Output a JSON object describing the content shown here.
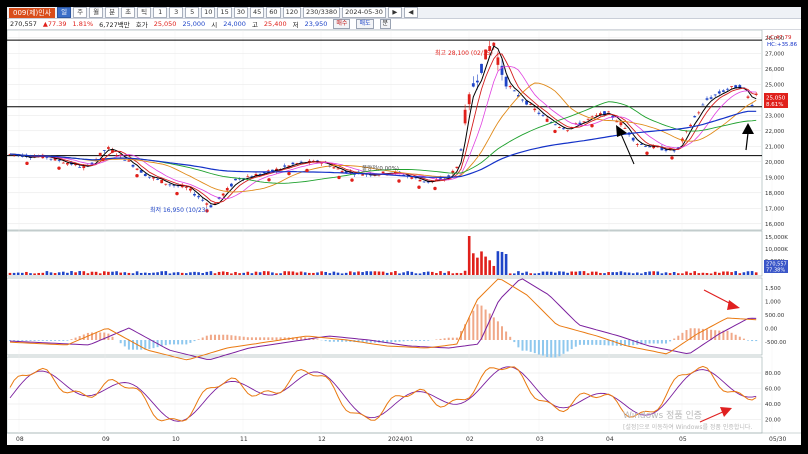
{
  "toolbar": {
    "stock_code": "009(제)인사",
    "view_buttons": [
      "일",
      "주",
      "월",
      "분",
      "초",
      "틱"
    ],
    "interval_buttons": [
      "1",
      "3",
      "5",
      "10",
      "15",
      "30",
      "45",
      "60",
      "120"
    ],
    "count_value": "230/3380",
    "date_value": "2024-05-30",
    "nav_buttons": [
      "▶",
      "◀"
    ]
  },
  "info": {
    "price": "270,557",
    "change1": "77.39",
    "change1_arrow": "▲",
    "rate": "1.81%",
    "volume": "6,727백만",
    "bid_label": "호가",
    "bid_value": "25,050",
    "ask_value": "25,000",
    "open_label": "시",
    "open_value": "24,000",
    "high_label": "고",
    "high_value": "25,400",
    "low_label": "저",
    "low_value": "23,950",
    "buy_label": "매수",
    "sell_label": "매도",
    "toggle_label": "분"
  },
  "chart_data": [
    {
      "type": "candlestick",
      "price_axis": [
        "28,000",
        "27,000",
        "26,000",
        "25,000",
        "24,000",
        "23,000",
        "22,000",
        "21,000",
        "20,000",
        "19,000",
        "18,000",
        "17,000",
        "16,000"
      ],
      "ylim": [
        15600,
        28500
      ],
      "top_right_labels": [
        "LC:47.79",
        "HC:+35.86"
      ],
      "last_price_labels": [
        "25,050",
        "8.61%"
      ],
      "annotations": {
        "high": "최고 28,100 (02/15)",
        "low": "최저 16,950 (10/23)",
        "neutral": "볼량적(0.00%)"
      },
      "horizontal_levels": [
        27850,
        23550,
        20400
      ],
      "moving_averages": [
        "MA5",
        "MA20",
        "MA60",
        "MA120"
      ]
    },
    {
      "type": "bar",
      "name": "volume",
      "axis": [
        "15,000K",
        "10,000K",
        "5,000K"
      ],
      "last_label": "270,557",
      "last_label_2": "77.38%"
    },
    {
      "type": "line",
      "name": "MACD",
      "axis": [
        "1,500",
        "1,000",
        "500.00",
        "0.00",
        "-500.00"
      ]
    },
    {
      "type": "line",
      "name": "stochastic",
      "axis": [
        "80.00",
        "60.00",
        "40.00",
        "20.00"
      ]
    }
  ],
  "x_axis": [
    "08",
    "09",
    "10",
    "11",
    "12",
    "2024/01",
    "02",
    "03",
    "04",
    "05",
    "05/30"
  ],
  "watermark": {
    "line1": "Windows 정품 인증",
    "line2": "[설정]으로 이동하여 Windows를 정품 인증합니다."
  },
  "colors": {
    "up": "#e0201b",
    "down": "#1f45c8",
    "ma5": "#d41e1e",
    "ma20": "#e08a19",
    "ma60": "#1fa12e",
    "ma120": "#1432c8",
    "macd": "#ea7a11",
    "signal": "#7b1f9e"
  }
}
